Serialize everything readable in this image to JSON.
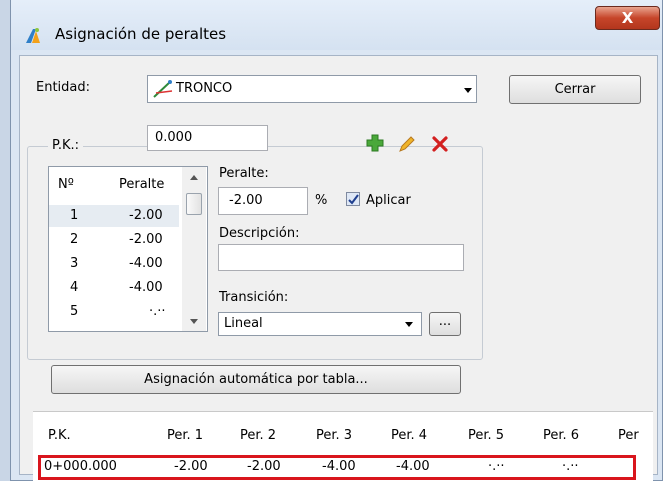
{
  "window": {
    "title": "Asignación de peraltes",
    "close_glyph": "X"
  },
  "entidad": {
    "label": "Entidad:",
    "value": "TRONCO",
    "icon": "road-axis-icon"
  },
  "cerrar_label": "Cerrar",
  "pk": {
    "label": "P.K.:",
    "value": "0.000"
  },
  "toolbar": {
    "add_icon": "plus-icon",
    "edit_icon": "pencil-icon",
    "delete_icon": "x-icon"
  },
  "list": {
    "headers": [
      "Nº",
      "Peralte"
    ],
    "rows": [
      {
        "n": "1",
        "peralte": "-2.00"
      },
      {
        "n": "2",
        "peralte": "-2.00"
      },
      {
        "n": "3",
        "peralte": "-4.00"
      },
      {
        "n": "4",
        "peralte": "-4.00"
      },
      {
        "n": "5",
        "peralte": "·.··"
      }
    ]
  },
  "peralte": {
    "label": "Peralte:",
    "value": "-2.00",
    "unit": "%",
    "aplicar_label": "Aplicar",
    "aplicar_checked": true
  },
  "descripcion": {
    "label": "Descripción:",
    "value": ""
  },
  "transicion": {
    "label": "Transición:",
    "value": "Lineal",
    "more_label": "..."
  },
  "auto_button_label": "Asignación automática por tabla...",
  "grid": {
    "headers": [
      "P.K.",
      "Per. 1",
      "Per. 2",
      "Per. 3",
      "Per. 4",
      "Per. 5",
      "Per. 6",
      "Per"
    ],
    "row": [
      "0+000.000",
      "-2.00",
      "-2.00",
      "-4.00",
      "-4.00",
      "·.··",
      "·.··",
      ""
    ]
  },
  "colors": {
    "accent": "#316ac5",
    "selection_outline": "#d9151d"
  }
}
